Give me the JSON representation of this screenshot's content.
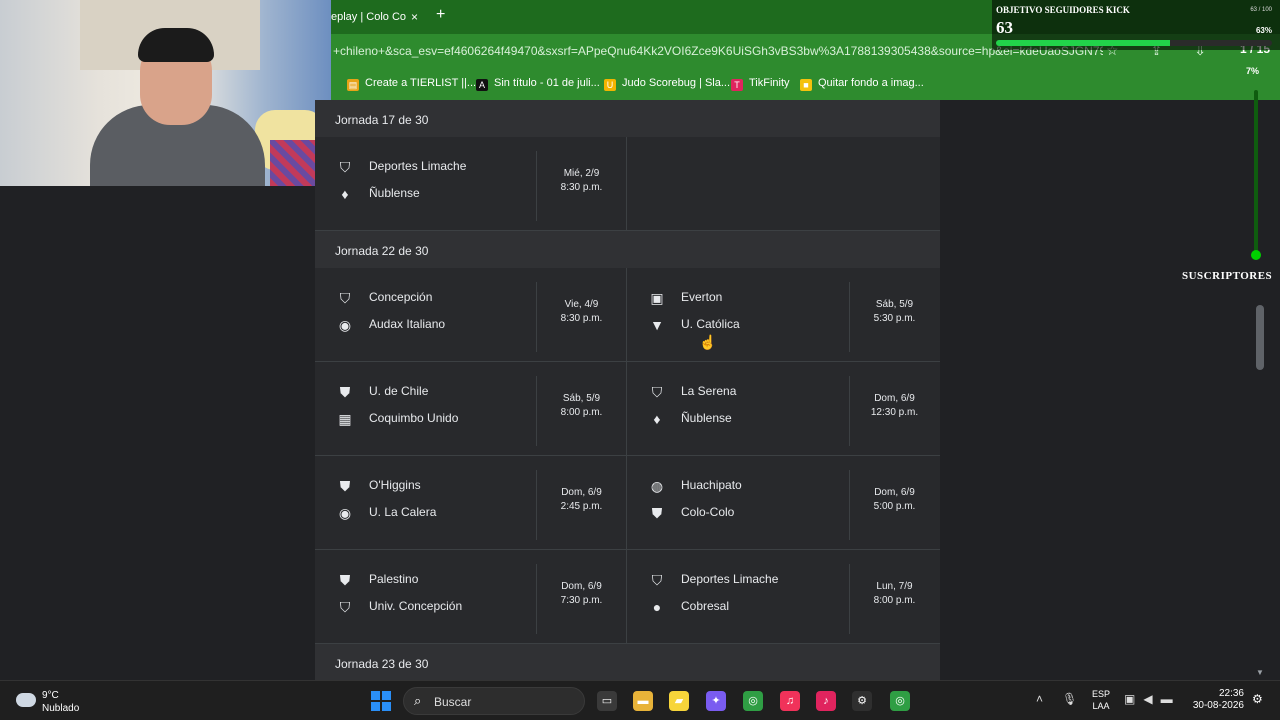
{
  "browser": {
    "tab_title": "eplay | Colo Co",
    "tab_close": "×",
    "new_tab": "+",
    "url": "+chileno+&sca_esv=ef4606264f49470&sxsrf=APpeQnu64Kk2VOI6Zce9K6UiSGh3vBS3bw%3A1788139305438&source=hp&ei=kdeUaoSJGN795O...",
    "page_counter": "1 / 15",
    "bookmarks": [
      {
        "label": "Create a TIERLIST ||...",
        "color": "#e8a317",
        "glyph": "▤"
      },
      {
        "label": "Sin título - 01 de juli...",
        "color": "#111111",
        "glyph": "A"
      },
      {
        "label": "Judo Scorebug | Sla...",
        "color": "#f2b400",
        "glyph": "U"
      },
      {
        "label": "TikFinity",
        "color": "#e0245e",
        "glyph": "T"
      },
      {
        "label": "Quitar fondo a imag...",
        "color": "#f4c20d",
        "glyph": "■"
      }
    ]
  },
  "kick_overlay": {
    "title": "OBJETIVO SEGUIDORES KICK",
    "count": "63",
    "ratio": "63 / 100",
    "percent_label": "63%",
    "progress": 0.63,
    "sub_percent": "7%",
    "subscribers_label": "SUSCRIPTORES"
  },
  "schedule": {
    "sections": [
      {
        "heading": "Jornada 17 de 30",
        "rows": [
          {
            "left": {
              "home": "Deportes Limache",
              "home_crest": "⛉",
              "away": "Ñublense",
              "away_crest": "♦",
              "day": "Mié, 2/9",
              "time": "8:30 p.m."
            },
            "right": null
          }
        ]
      },
      {
        "heading": "Jornada 22 de 30",
        "rows": [
          {
            "left": {
              "home": "Concepción",
              "home_crest": "⛉",
              "away": "Audax Italiano",
              "away_crest": "◉",
              "day": "Vie, 4/9",
              "time": "8:30 p.m."
            },
            "right": {
              "home": "Everton",
              "home_crest": "▣",
              "away": "U. Católica",
              "away_crest": "▼",
              "day": "Sáb, 5/9",
              "time": "5:30 p.m."
            }
          },
          {
            "left": {
              "home": "U. de Chile",
              "home_crest": "⛊",
              "away": "Coquimbo Unido",
              "away_crest": "▦",
              "day": "Sáb, 5/9",
              "time": "8:00 p.m."
            },
            "right": {
              "home": "La Serena",
              "home_crest": "⛉",
              "away": "Ñublense",
              "away_crest": "♦",
              "day": "Dom, 6/9",
              "time": "12:30 p.m."
            }
          },
          {
            "left": {
              "home": "O'Higgins",
              "home_crest": "⛊",
              "away": "U. La Calera",
              "away_crest": "◉",
              "day": "Dom, 6/9",
              "time": "2:45 p.m."
            },
            "right": {
              "home": "Huachipato",
              "home_crest": "◍",
              "away": "Colo-Colo",
              "away_crest": "⛊",
              "day": "Dom, 6/9",
              "time": "5:00 p.m."
            }
          },
          {
            "left": {
              "home": "Palestino",
              "home_crest": "⛊",
              "away": "Univ. Concepción",
              "away_crest": "⛉",
              "day": "Dom, 6/9",
              "time": "7:30 p.m."
            },
            "right": {
              "home": "Deportes Limache",
              "home_crest": "⛉",
              "away": "Cobresal",
              "away_crest": "●",
              "day": "Lun, 7/9",
              "time": "8:00 p.m."
            }
          }
        ]
      },
      {
        "heading": "Jornada 23 de 30",
        "rows": []
      }
    ]
  },
  "taskbar": {
    "weather_temp": "9°C",
    "weather_desc": "Nublado",
    "search_placeholder": "Buscar",
    "lang_top": "ESP",
    "lang_bottom": "LAA",
    "time": "22:36",
    "date": "30-08-2026",
    "apps": [
      {
        "name": "task-view",
        "color": "#3a3a3a",
        "glyph": "▭"
      },
      {
        "name": "file-explorer",
        "color": "#e8b339",
        "glyph": "▬"
      },
      {
        "name": "sticky-notes",
        "color": "#f7d53a",
        "glyph": "▰"
      },
      {
        "name": "copilot",
        "color": "#7a5cf0",
        "glyph": "✦"
      },
      {
        "name": "chrome",
        "color": "#2f9e44",
        "glyph": "◎"
      },
      {
        "name": "itunes",
        "color": "#f0325a",
        "glyph": "♫"
      },
      {
        "name": "tiktok",
        "color": "#e0245e",
        "glyph": "♪"
      },
      {
        "name": "settings",
        "color": "#2f2f2f",
        "glyph": "⚙"
      },
      {
        "name": "chrome-active",
        "color": "#2f9e44",
        "glyph": "◎"
      }
    ]
  }
}
